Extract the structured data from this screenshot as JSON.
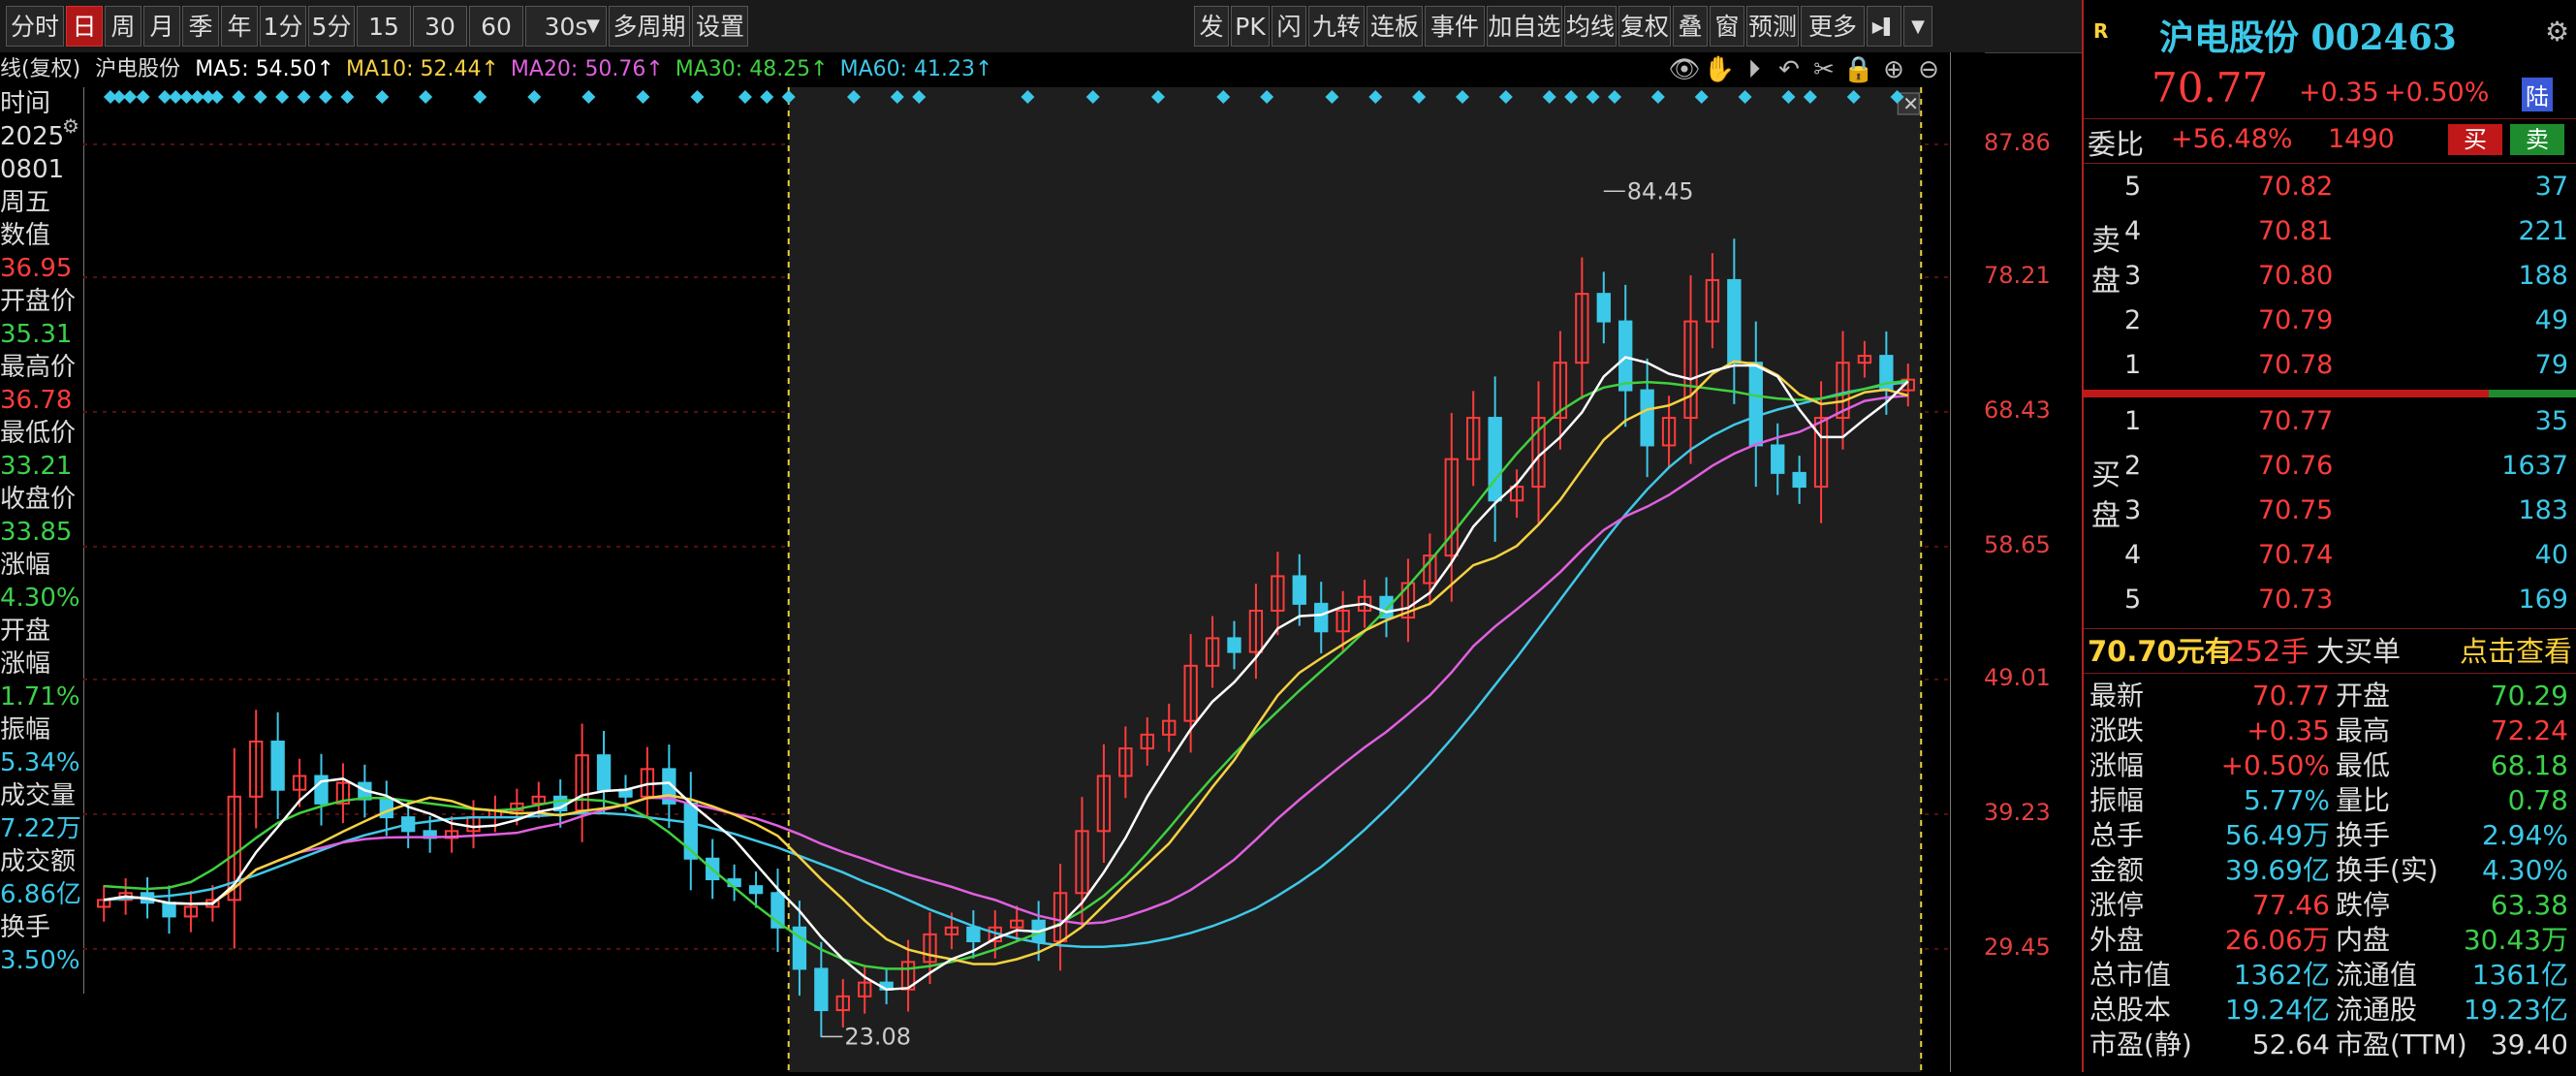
{
  "toolbar": {
    "left": [
      {
        "label": "分时",
        "active": false
      },
      {
        "label": "日",
        "active": true
      },
      {
        "label": "周",
        "active": false
      },
      {
        "label": "月",
        "active": false
      },
      {
        "label": "季",
        "active": false
      },
      {
        "label": "年",
        "active": false
      },
      {
        "label": "1分",
        "active": false
      },
      {
        "label": "5分",
        "active": false
      },
      {
        "label": "15分",
        "active": false
      },
      {
        "label": "30分",
        "active": false
      },
      {
        "label": "60分",
        "active": false
      },
      {
        "label": "30s",
        "active": false
      },
      {
        "label": "多周期",
        "active": false
      },
      {
        "label": "设置",
        "active": false
      }
    ],
    "right": [
      "发",
      "PK",
      "闪",
      "九转",
      "连板",
      "事件",
      "加自选",
      "均线",
      "复权",
      "叠",
      "窗",
      "预测",
      "更多"
    ]
  },
  "ma_header": {
    "prefix": "线(复权)",
    "name": "沪电股份",
    "items": [
      {
        "label": "MA5: 54.50↑",
        "color": "#ffffff"
      },
      {
        "label": "MA10: 52.44↑",
        "color": "#f5d142"
      },
      {
        "label": "MA20: 50.76↑",
        "color": "#e060e0"
      },
      {
        "label": "MA30: 48.25↑",
        "color": "#40d040"
      },
      {
        "label": "MA60: 41.23↑",
        "color": "#40c8e8"
      }
    ]
  },
  "left_panel": [
    {
      "text": "时间",
      "color": "#dddddd"
    },
    {
      "text": "2025",
      "color": "#dddddd"
    },
    {
      "text": "0801",
      "color": "#dddddd"
    },
    {
      "text": "周五",
      "color": "#dddddd"
    },
    {
      "text": "数值",
      "color": "#dddddd"
    },
    {
      "text": "36.95",
      "color": "#ff3c3c"
    },
    {
      "text": "开盘价",
      "color": "#dddddd"
    },
    {
      "text": "35.31",
      "color": "#3cd04a"
    },
    {
      "text": "最高价",
      "color": "#dddddd"
    },
    {
      "text": "36.78",
      "color": "#ff3c3c"
    },
    {
      "text": "最低价",
      "color": "#dddddd"
    },
    {
      "text": "33.21",
      "color": "#3cd04a"
    },
    {
      "text": "收盘价",
      "color": "#dddddd"
    },
    {
      "text": "33.85",
      "color": "#3cd04a"
    },
    {
      "text": "涨幅",
      "color": "#dddddd"
    },
    {
      "text": "4.30%",
      "color": "#3cd04a"
    },
    {
      "text": "开盘",
      "color": "#dddddd"
    },
    {
      "text": "涨幅",
      "color": "#dddddd"
    },
    {
      "text": "1.71%",
      "color": "#3cd04a"
    },
    {
      "text": "振幅",
      "color": "#dddddd"
    },
    {
      "text": "5.34%",
      "color": "#3cc8e8"
    },
    {
      "text": "成交量",
      "color": "#dddddd"
    },
    {
      "text": "7.22万",
      "color": "#3cc8e8"
    },
    {
      "text": "成交额",
      "color": "#dddddd"
    },
    {
      "text": "6.86亿",
      "color": "#3cc8e8"
    },
    {
      "text": "换手",
      "color": "#dddddd"
    },
    {
      "text": "3.50%",
      "color": "#3cc8e8"
    }
  ],
  "chart_data": {
    "type": "candlestick",
    "y_ticks": [
      "87.86",
      "78.21",
      "68.43",
      "58.65",
      "49.01",
      "39.23",
      "29.45"
    ],
    "ylim": [
      20.5,
      92
    ],
    "annotations": {
      "high": "84.45",
      "low": "23.08"
    },
    "colors": {
      "up": "#ff3c3c",
      "down": "#3cc8e8",
      "ma5": "#ffffff",
      "ma10": "#f5d142",
      "ma20": "#e060e0",
      "ma30": "#40d040",
      "ma60": "#40c8e8"
    },
    "ma60": [
      33.0,
      33.1,
      33.2,
      33.3,
      33.5,
      33.8,
      34.3,
      34.8,
      35.4,
      36.0,
      36.6,
      37.2,
      37.7,
      38.1,
      38.5,
      38.7,
      38.9,
      39.0,
      39.0,
      39.0,
      39.1,
      39.2,
      39.3,
      39.3,
      39.2,
      39.0,
      38.8,
      38.6,
      38.2,
      37.8,
      37.3,
      36.8,
      36.2,
      35.6,
      35.0,
      34.3,
      33.7,
      33.0,
      32.3,
      31.7,
      31.1,
      30.6,
      30.2,
      29.9,
      29.7,
      29.6,
      29.6,
      29.7,
      29.9,
      30.2,
      30.6,
      31.1,
      31.7,
      32.4,
      33.3,
      34.3,
      35.4,
      36.7,
      38.1,
      39.6,
      41.2,
      42.9,
      44.7,
      46.6,
      48.6,
      50.6,
      52.7,
      54.8,
      56.9,
      59.0,
      61.0,
      62.8,
      64.4,
      65.7,
      66.7,
      67.5,
      68.1,
      68.6,
      69.0,
      69.4,
      69.8,
      70.1,
      70.4,
      70.6
    ],
    "ma30": [
      34.0,
      33.9,
      33.8,
      33.9,
      34.3,
      35.2,
      36.3,
      37.5,
      38.6,
      39.3,
      39.8,
      40.2,
      40.4,
      40.4,
      40.2,
      40.0,
      39.8,
      39.6,
      39.5,
      39.6,
      39.9,
      40.2,
      40.3,
      40.2,
      39.8,
      39.0,
      37.9,
      36.6,
      35.2,
      33.9,
      32.6,
      31.4,
      30.3,
      29.4,
      28.7,
      28.2,
      28.0,
      28.0,
      28.2,
      28.5,
      28.9,
      29.4,
      30.0,
      30.6,
      31.3,
      32.2,
      33.3,
      34.7,
      36.4,
      38.2,
      40.1,
      41.9,
      43.6,
      45.2,
      46.7,
      48.2,
      49.6,
      51.0,
      52.5,
      54.1,
      55.8,
      57.6,
      59.5,
      61.5,
      63.5,
      65.4,
      67.1,
      68.5,
      69.5,
      70.2,
      70.5,
      70.6,
      70.5,
      70.3,
      70.1,
      69.9,
      69.6,
      69.4,
      69.3,
      69.4,
      69.7,
      70.1,
      70.5,
      70.7
    ],
    "closes": [
      33.0,
      33.5,
      32.8,
      31.8,
      32.5,
      33.0,
      40.5,
      44.5,
      41.0,
      42.0,
      40.0,
      41.5,
      40.3,
      39.0,
      38.0,
      37.5,
      38.0,
      39.0,
      39.5,
      40.0,
      40.5,
      39.5,
      43.5,
      41.0,
      40.5,
      42.5,
      40.0,
      36.0,
      34.5,
      34.0,
      33.5,
      31.0,
      28.0,
      25.0,
      26.0,
      27.0,
      26.5,
      28.5,
      30.5,
      31.0,
      30.0,
      31.0,
      31.5,
      30.0,
      33.5,
      38.0,
      42.0,
      44.0,
      45.0,
      46.0,
      50.0,
      52.0,
      51.0,
      54.0,
      56.5,
      54.5,
      52.5,
      54.0,
      55.0,
      53.5,
      56.0,
      58.0,
      65.0,
      68.0,
      62.0,
      63.0,
      68.0,
      72.0,
      77.0,
      75.0,
      70.0,
      66.0,
      68.0,
      75.0,
      78.0,
      72.0,
      66.0,
      64.0,
      63.0,
      68.0,
      72.0,
      72.5,
      70.0,
      70.77
    ]
  },
  "right_panel": {
    "r_badge": "R",
    "stock_name": "沪电股份 002463",
    "price": "70.77",
    "change": "+0.35",
    "change_pct": "+0.50%",
    "market_badge": "陆",
    "weibi_label": "委比",
    "weibi_value": "+56.48%",
    "weicha_value": "1490",
    "buy_btn": "买",
    "sell_btn": "卖",
    "sell_label": "卖盘",
    "buy_label": "买盘",
    "asks": [
      {
        "lv": "5",
        "price": "70.82",
        "vol": "37"
      },
      {
        "lv": "4",
        "price": "70.81",
        "vol": "221"
      },
      {
        "lv": "3",
        "price": "70.80",
        "vol": "188"
      },
      {
        "lv": "2",
        "price": "70.79",
        "vol": "49"
      },
      {
        "lv": "1",
        "price": "70.78",
        "vol": "79"
      }
    ],
    "bids": [
      {
        "lv": "1",
        "price": "70.77",
        "vol": "35"
      },
      {
        "lv": "2",
        "price": "70.76",
        "vol": "1637"
      },
      {
        "lv": "3",
        "price": "70.75",
        "vol": "183"
      },
      {
        "lv": "4",
        "price": "70.74",
        "vol": "40"
      },
      {
        "lv": "5",
        "price": "70.73",
        "vol": "169"
      }
    ],
    "big_order": {
      "price": "70.70元有",
      "vol": "252手",
      "label": "大买单",
      "link": "点击查看"
    },
    "quote": [
      {
        "k1": "最新",
        "v1": "70.77",
        "c1": "#ff3c3c",
        "k2": "开盘",
        "v2": "70.29",
        "c2": "#3cd04a"
      },
      {
        "k1": "涨跌",
        "v1": "+0.35",
        "c1": "#ff3c3c",
        "k2": "最高",
        "v2": "72.24",
        "c2": "#ff3c3c"
      },
      {
        "k1": "涨幅",
        "v1": "+0.50%",
        "c1": "#ff3c3c",
        "k2": "最低",
        "v2": "68.18",
        "c2": "#3cd04a"
      },
      {
        "k1": "振幅",
        "v1": "5.77%",
        "c1": "#3cc8e8",
        "k2": "量比",
        "v2": "0.78",
        "c2": "#3cd04a"
      },
      {
        "k1": "总手",
        "v1": "56.49万",
        "c1": "#3cc8e8",
        "k2": "换手",
        "v2": "2.94%",
        "c2": "#3cc8e8"
      },
      {
        "k1": "金额",
        "v1": "39.69亿",
        "c1": "#3cc8e8",
        "k2": "换手(实)",
        "v2": "4.30%",
        "c2": "#3cc8e8"
      },
      {
        "k1": "涨停",
        "v1": "77.46",
        "c1": "#ff3c3c",
        "k2": "跌停",
        "v2": "63.38",
        "c2": "#3cd04a"
      },
      {
        "k1": "外盘",
        "v1": "26.06万",
        "c1": "#ff3c3c",
        "k2": "内盘",
        "v2": "30.43万",
        "c2": "#3cd04a"
      },
      {
        "k1": "总市值",
        "v1": "1362亿",
        "c1": "#3cc8e8",
        "k2": "流通值",
        "v2": "1361亿",
        "c2": "#3cc8e8"
      },
      {
        "k1": "总股本",
        "v1": "19.24亿",
        "c1": "#3cc8e8",
        "k2": "流通股",
        "v2": "19.23亿",
        "c2": "#3cc8e8"
      },
      {
        "k1": "市盈(静)",
        "v1": "52.64",
        "c1": "#dddddd",
        "k2": "市盈(TTM)",
        "v2": "39.40",
        "c2": "#dddddd"
      }
    ]
  }
}
